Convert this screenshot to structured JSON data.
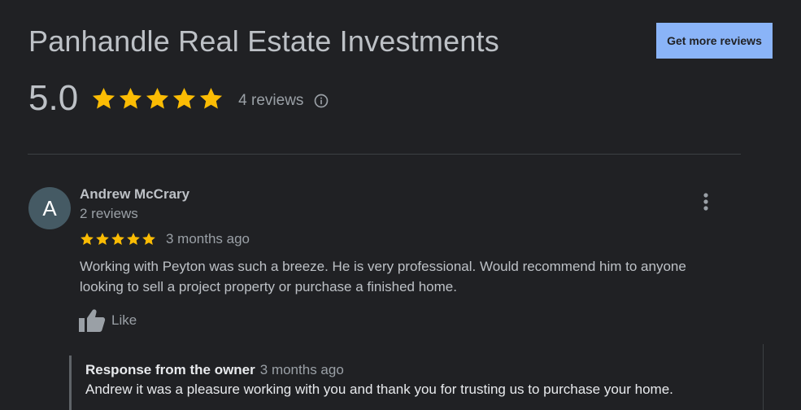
{
  "header": {
    "business_name": "Panhandle Real Estate Investments",
    "get_more_reviews_label": "Get more reviews"
  },
  "summary": {
    "rating": "5.0",
    "stars": 5,
    "review_count_text": "4 reviews"
  },
  "review": {
    "avatar_letter": "A",
    "reviewer_name": "Andrew McCrary",
    "reviewer_review_count": "2 reviews",
    "stars": 5,
    "date": "3 months ago",
    "text": "Working with Peyton was such a breeze. He is very professional.  Would recommend him to anyone looking to sell a project property or purchase a finished home.",
    "like_label": "Like",
    "owner_response": {
      "label": "Response from the owner",
      "date": "3 months ago",
      "text": "Andrew it was a pleasure working with you and thank you for trusting us to purchase your home."
    }
  },
  "colors": {
    "background": "#202124",
    "star": "#fbbc04",
    "button": "#8ab4f8"
  },
  "icons": {
    "rating_star": "star-icon",
    "info": "info-icon",
    "menu": "more-vert-icon",
    "like": "thumbs-up-icon"
  }
}
